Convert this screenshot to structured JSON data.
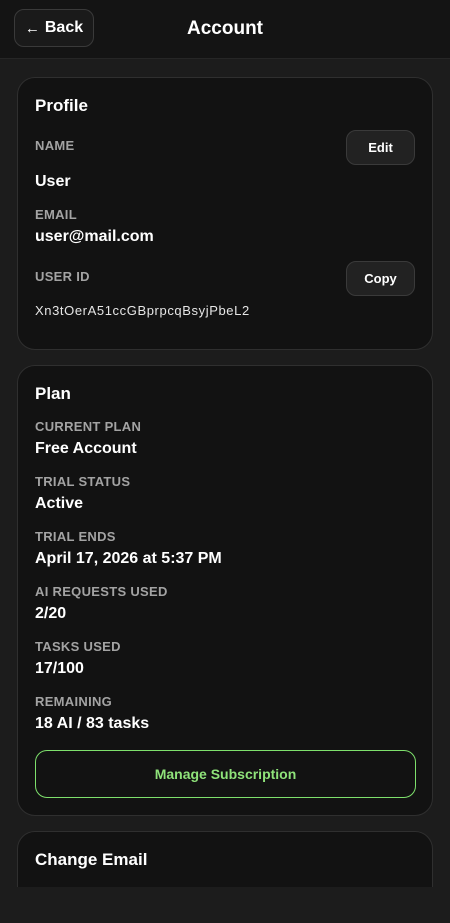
{
  "header": {
    "back_label": "Back",
    "title": "Account"
  },
  "profile": {
    "title": "Profile",
    "name_label": "NAME",
    "name_value": "User",
    "edit_label": "Edit",
    "email_label": "EMAIL",
    "email_value": "user@mail.com",
    "user_id_label": "USER ID",
    "user_id_value": "Xn3tOerA51ccGBprpcqBsyjPbeL2",
    "copy_label": "Copy"
  },
  "plan": {
    "title": "Plan",
    "current_plan_label": "CURRENT PLAN",
    "current_plan_value": "Free Account",
    "trial_status_label": "TRIAL STATUS",
    "trial_status_value": "Active",
    "trial_ends_label": "TRIAL ENDS",
    "trial_ends_value": "April 17, 2026 at 5:37 PM",
    "ai_requests_label": "AI REQUESTS USED",
    "ai_requests_value": "2/20",
    "tasks_used_label": "TASKS USED",
    "tasks_used_value": "17/100",
    "remaining_label": "REMAINING",
    "remaining_value": "18 AI / 83 tasks",
    "manage_label": "Manage Subscription"
  },
  "change_email": {
    "title": "Change Email"
  },
  "colors": {
    "accent_green": "#8fe37a",
    "background": "#1c1c1c",
    "card": "#121212"
  },
  "icons": {
    "back": "arrow-left-icon"
  }
}
